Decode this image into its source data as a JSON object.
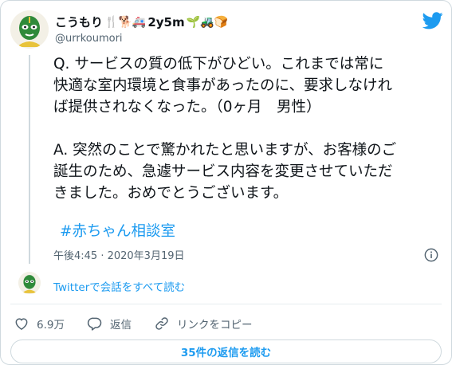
{
  "author": {
    "display_name": "こうもり",
    "emoji_string": "🍴🐕🚑",
    "age_tag": "2y5m",
    "emoji_string_2": "🌱🚜🍞",
    "handle": "@urrkoumori"
  },
  "tweet": {
    "text": "Q. サービスの質の低下がひどい。これまでは常に\n快適な室内環境と食事があったのに、要求しなけれ\nば提供されなくなった。（0ヶ月　男性）\n\nA. 突然のことで驚かれたと思いますが、お客様のご\n誕生のため、急遽サービス内容を変更させていただ\nきました。おめでとうございます。",
    "hashtag": "#赤ちゃん相談室",
    "timestamp": "午後4:45 · 2020年3月19日"
  },
  "thread_link": "Twitterで会話をすべて読む",
  "actions": {
    "like_count": "6.9万",
    "reply_label": "返信",
    "copy_link_label": "リンクをコピー"
  },
  "replies_button": "35件の返信を読む",
  "colors": {
    "accent": "#1d9bf0",
    "text": "#0f1419",
    "muted": "#536471",
    "border": "#cfd9de"
  }
}
